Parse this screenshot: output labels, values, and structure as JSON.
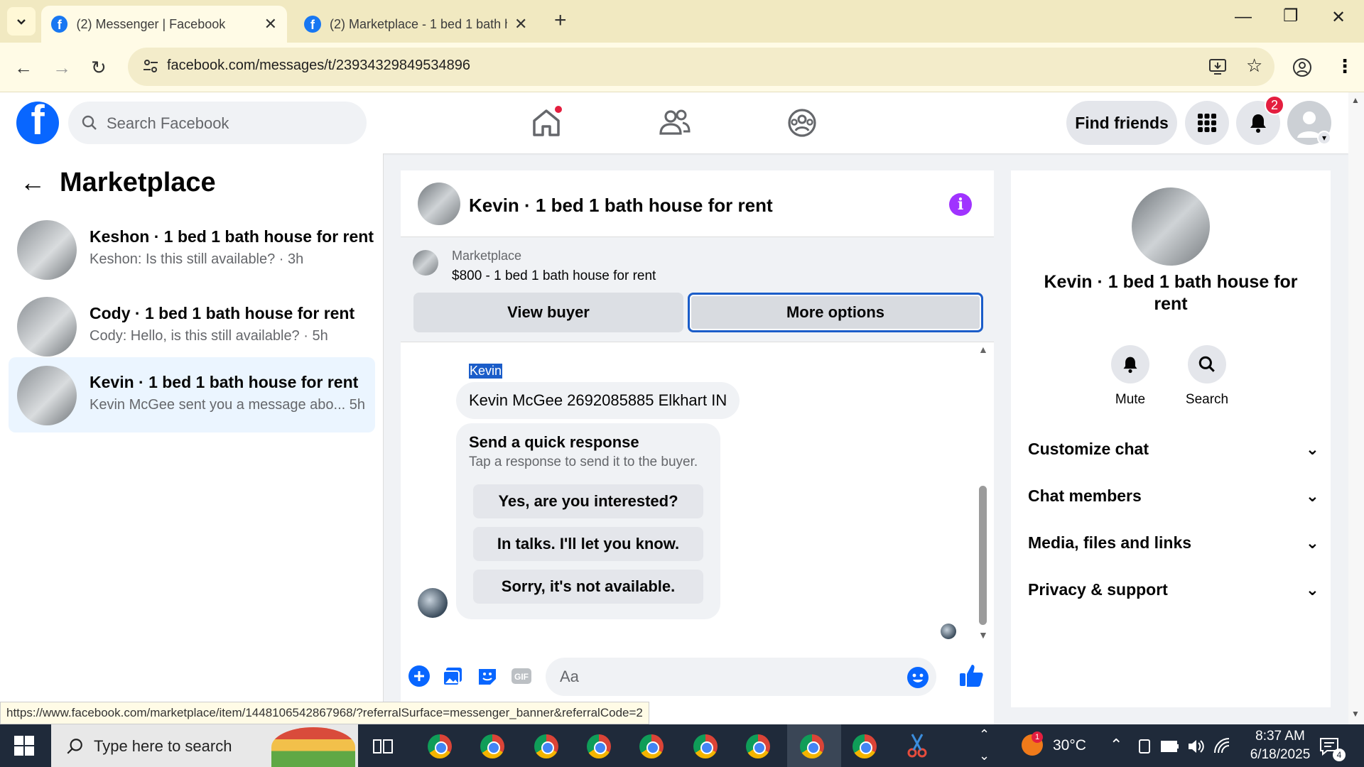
{
  "browser": {
    "tabs": [
      {
        "title": "(2) Messenger | Facebook",
        "active": true
      },
      {
        "title": "(2) Marketplace - 1 bed 1 bath h",
        "active": false
      }
    ],
    "url": "facebook.com/messages/t/23934329849534896"
  },
  "fb_header": {
    "search_placeholder": "Search Facebook",
    "find_friends_label": "Find friends",
    "notification_count": "2"
  },
  "sidebar": {
    "title": "Marketplace",
    "conversations": [
      {
        "name": "Keshon · 1 bed 1 bath house for rent",
        "preview": "Keshon: Is this still available? · 3h"
      },
      {
        "name": "Cody · 1 bed 1 bath house for rent",
        "preview": "Cody: Hello, is this still available? · 5h"
      },
      {
        "name": "Kevin · 1 bed 1 bath house for rent",
        "preview": "Kevin McGee sent you a message abo...   5h"
      }
    ]
  },
  "chat": {
    "title": "Kevin · 1 bed 1 bath house for rent",
    "banner": {
      "label": "Marketplace",
      "listing": "$800 - 1 bed 1 bath house for rent",
      "view_buyer_label": "View buyer",
      "more_options_label": "More options"
    },
    "sender_name": "Kevin",
    "message": "Kevin McGee 2692085885 Elkhart IN",
    "quick_response": {
      "title": "Send a quick response",
      "subtitle": "Tap a response to send it to the buyer.",
      "options": [
        "Yes, are you interested?",
        "In talks. I'll let you know.",
        "Sorry, it's not available."
      ]
    },
    "composer_placeholder": "Aa"
  },
  "details": {
    "title": "Kevin · 1 bed 1 bath house for rent",
    "actions": [
      "Mute",
      "Search"
    ],
    "sections": [
      "Customize chat",
      "Chat members",
      "Media, files and links",
      "Privacy & support"
    ]
  },
  "status_link": "https://www.facebook.com/marketplace/item/1448106542867968/?referralSurface=messenger_banner&referralCode=2",
  "taskbar": {
    "search_placeholder": "Type here to search",
    "temperature": "30°C",
    "weather_badge": "1",
    "time": "8:37 AM",
    "date": "6/18/2025",
    "notification_count": "4"
  },
  "colors": {
    "fb_blue": "#0866ff",
    "selection_blue": "#1b5dc9",
    "info_purple": "#a033ff",
    "badge_red": "#e41e3f"
  }
}
